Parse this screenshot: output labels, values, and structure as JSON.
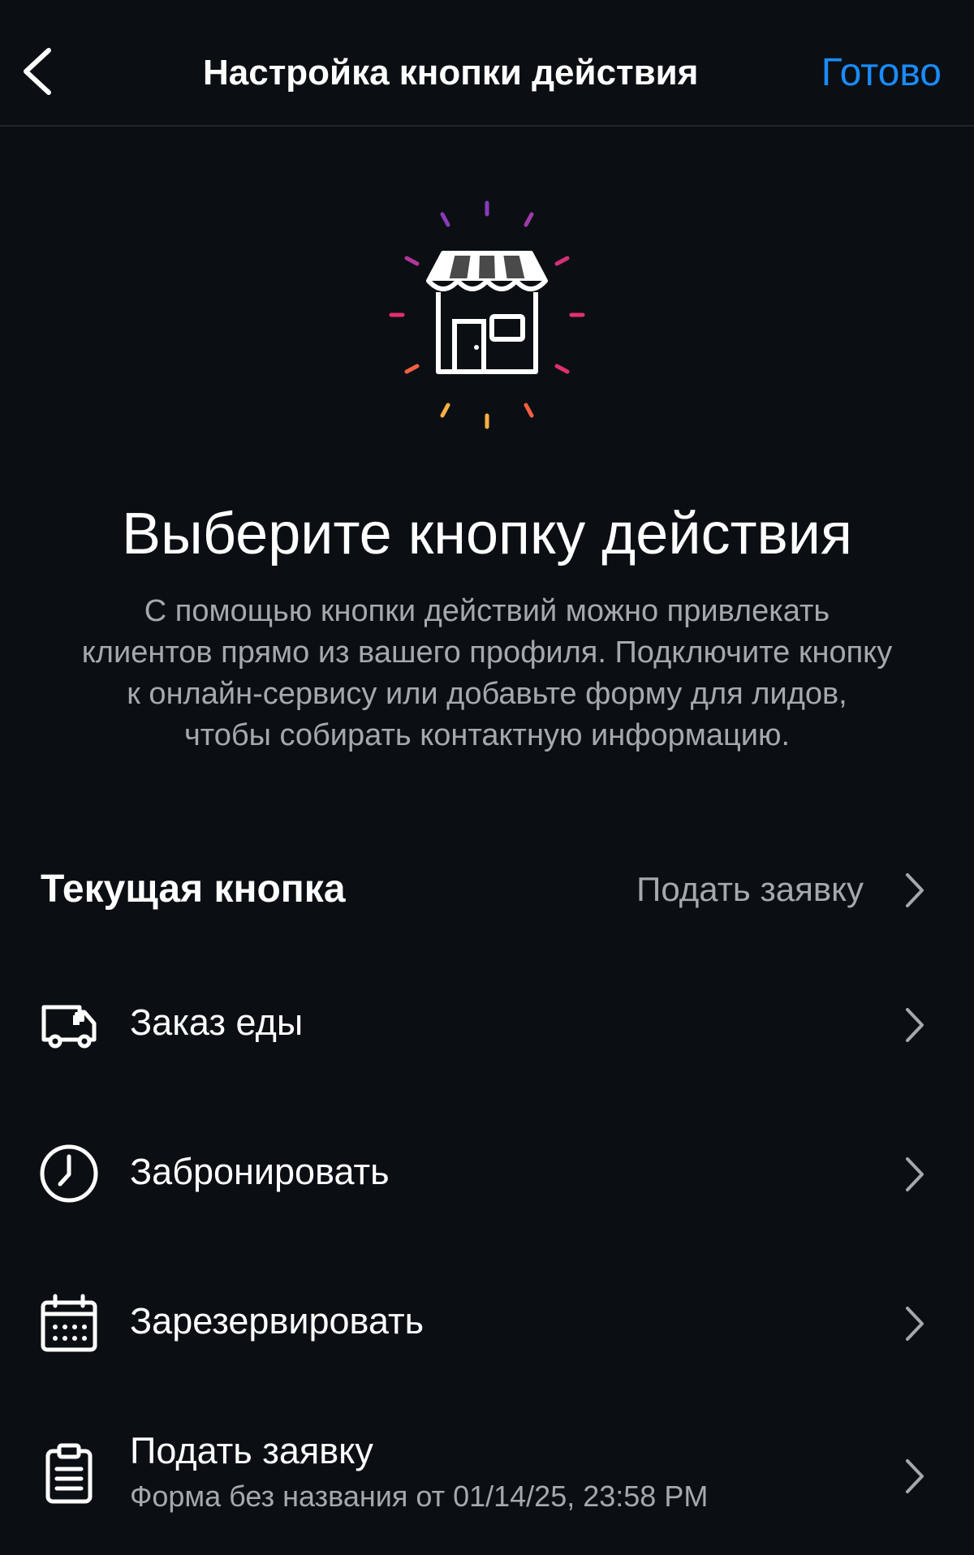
{
  "header": {
    "title": "Настройка кнопки действия",
    "done_label": "Готово"
  },
  "intro": {
    "title": "Выберите кнопку действия",
    "description": "С помощью кнопки действий можно привлекать клиентов прямо из вашего профиля. Подключите кнопку к онлайн-сервису или добавьте форму для лидов, чтобы собирать контактную информацию."
  },
  "current_button": {
    "label": "Текущая кнопка",
    "value": "Подать заявку"
  },
  "options": [
    {
      "label": "Заказ еды",
      "icon": "delivery-truck-icon"
    },
    {
      "label": "Забронировать",
      "icon": "clock-icon"
    },
    {
      "label": "Зарезервировать",
      "icon": "calendar-icon"
    },
    {
      "label": "Подать заявку",
      "sublabel": "Форма без названия от 01/14/25, 23:58 PM",
      "icon": "clipboard-icon"
    }
  ],
  "colors": {
    "background": "#0b0f14",
    "accent": "#1a8cff",
    "secondary_text": "#a4a9ae",
    "ray_purple": "#8a3ab9",
    "ray_magenta": "#e1306c",
    "ray_orange": "#f56040",
    "ray_yellow": "#fcaf45"
  }
}
